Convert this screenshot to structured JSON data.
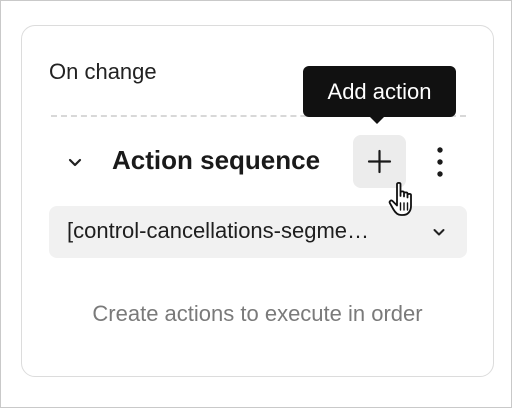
{
  "panel": {
    "trigger_label": "On change"
  },
  "tooltip": {
    "text": "Add action"
  },
  "section": {
    "title": "Action sequence"
  },
  "select": {
    "value": "[control-cancellations-segme…"
  },
  "empty_state": {
    "text": "Create actions to execute in order"
  },
  "icons": {
    "collapse": "chevron-down-icon",
    "add": "plus-icon",
    "more": "vertical-ellipsis-icon",
    "cursor": "hand-pointer-icon",
    "select": "chevron-down-icon"
  }
}
